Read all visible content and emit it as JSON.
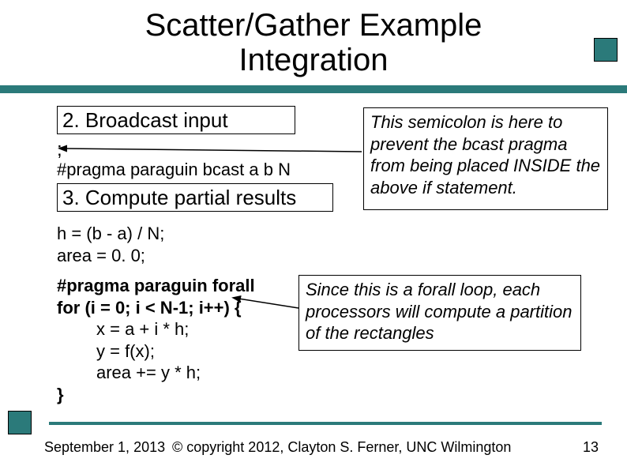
{
  "title_line1": "Scatter/Gather Example",
  "title_line2": "Integration",
  "step2": "2.  Broadcast input",
  "semicolon": ";",
  "pragma_bcast": "#pragma paraguin bcast a b N",
  "step3": "3.  Compute partial results",
  "note1": "This semicolon is here to prevent the bcast pragma from being placed INSIDE the above if statement.",
  "code_h": "h = (b - a) / N;",
  "code_area0": "area = 0. 0;",
  "pragma_forall": "#pragma paraguin forall",
  "code_for": "for (i = 0; i < N-1; i++) {",
  "code_x": "x = a + i * h;",
  "code_y": "y = f(x);",
  "code_area": "area += y * h;",
  "code_close": "}",
  "note2": "Since this is a forall loop, each processors will compute a partition of the rectangles",
  "footer_date": "September 1, 2013",
  "footer_copy": "© copyright 2012, Clayton S. Ferner, UNC Wilmington",
  "footer_page": "13"
}
